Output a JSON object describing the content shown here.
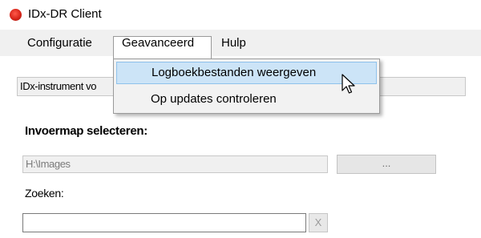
{
  "window": {
    "title": "IDx-DR Client",
    "app_icon": "app-logo-icon",
    "accent": "#d8261a"
  },
  "menubar": {
    "items": [
      "Configuratie",
      "Geavanceerd",
      "Hulp"
    ]
  },
  "dropdown": {
    "items": [
      "Logboekbestanden weergeven",
      "Op updates controleren"
    ],
    "highlight_color": "#cce4f7"
  },
  "instrument": {
    "value": "IDx-instrument vo"
  },
  "input_folder": {
    "label": "Invoermap selecteren:",
    "path": "H:\\Images",
    "browse_label": "..."
  },
  "search": {
    "label": "Zoeken:",
    "value": "",
    "clear_label": "X"
  },
  "cursor": {
    "icon": "mouse-pointer-icon"
  }
}
